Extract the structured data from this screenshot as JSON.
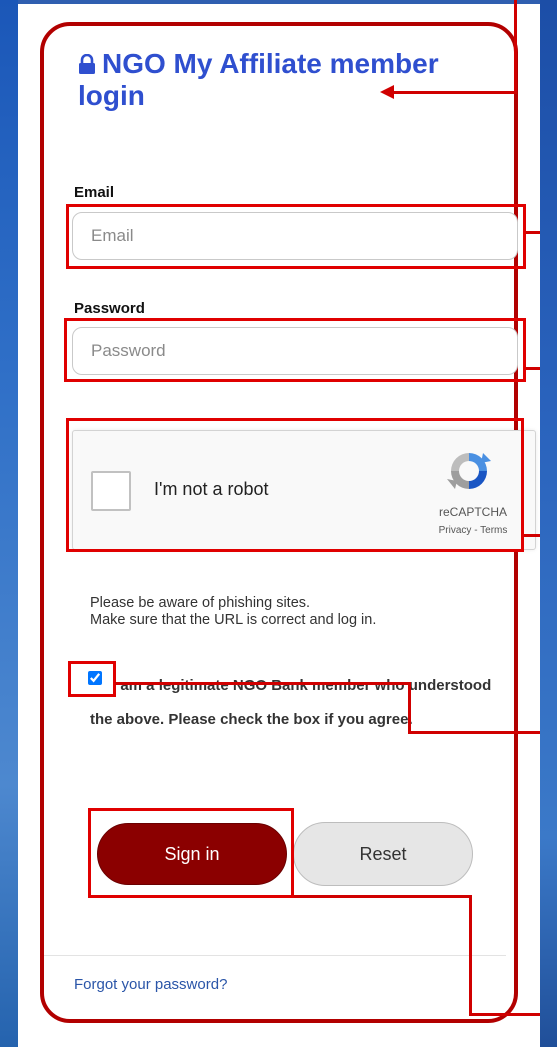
{
  "login": {
    "title": "NGO My Affiliate member login",
    "email_label": "Email",
    "email_placeholder": "Email",
    "password_label": "Password",
    "password_placeholder": "Password",
    "captcha_text": "I'm not a robot",
    "captcha_brand": "reCAPTCHA",
    "captcha_links": "Privacy - Terms",
    "notice_line1": "Please be aware of phishing sites.",
    "notice_line2": "Make sure that the URL is correct and log in.",
    "agree_text": "I am a legitimate NGO Bank member who understood the above. Please check the box if you agree.",
    "agree_checked": true,
    "signin_label": "Sign in",
    "reset_label": "Reset",
    "forgot_label": "Forgot your password?"
  },
  "colors": {
    "accent_red": "#b20000",
    "title_blue": "#2f4fcf",
    "signin_bg": "#8b0000",
    "link_blue": "#2a55a8"
  }
}
